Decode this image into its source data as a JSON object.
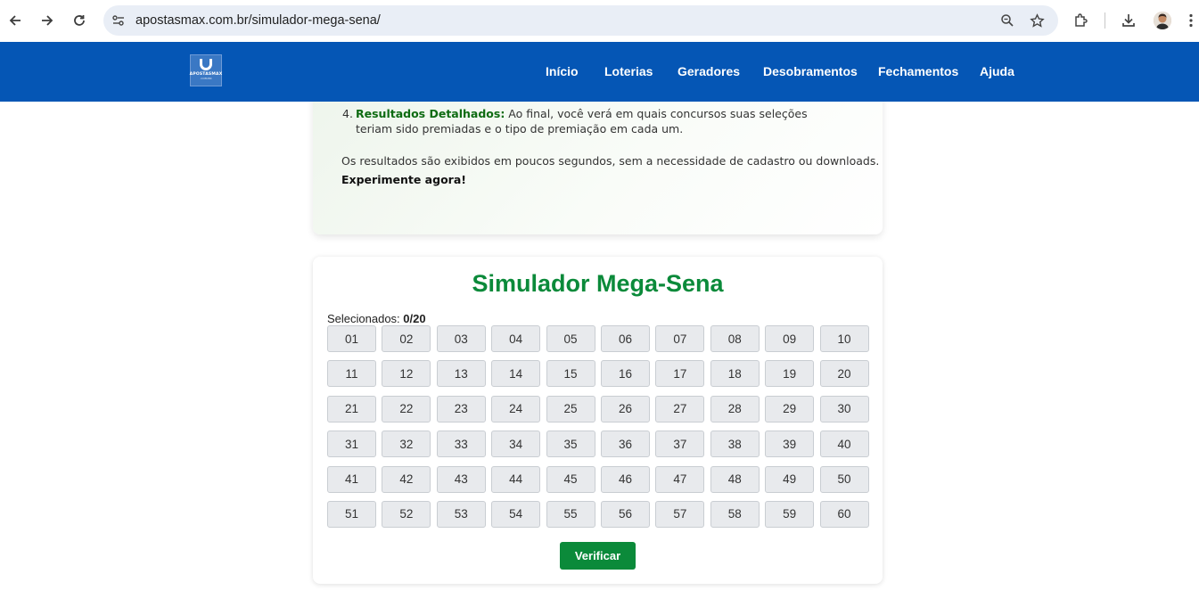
{
  "browser": {
    "url": "apostasmax.com.br/simulador-mega-sena/",
    "icons": [
      "back-icon",
      "forward-icon",
      "reload-icon",
      "site-settings-icon",
      "zoom-icon",
      "bookmark-star-icon",
      "extensions-icon",
      "download-icon",
      "profile-avatar",
      "more-menu-icon"
    ]
  },
  "header": {
    "logo_text": "APOSTASMAX",
    "logo_sub": ".COM.BR",
    "menu": [
      "Início",
      "Loterias",
      "Geradores",
      "Desobramentos",
      "Fechamentos",
      "Ajuda"
    ]
  },
  "info": {
    "item_number": "4.",
    "item_title": "Resultados Detalhados:",
    "item_text": " Ao final, você verá em quais concursos suas seleções teriam sido premiadas e o tipo de premiação em cada um.",
    "paragraph": "Os resultados são exibidos em poucos segundos, sem a necessidade de cadastro ou downloads.",
    "cta": "Experimente agora!"
  },
  "simulator": {
    "title": "Simulador Mega-Sena",
    "selected_label": "Selecionados: ",
    "selected_value": "0/20",
    "numbers": [
      "01",
      "02",
      "03",
      "04",
      "05",
      "06",
      "07",
      "08",
      "09",
      "10",
      "11",
      "12",
      "13",
      "14",
      "15",
      "16",
      "17",
      "18",
      "19",
      "20",
      "21",
      "22",
      "23",
      "24",
      "25",
      "26",
      "27",
      "28",
      "29",
      "30",
      "31",
      "32",
      "33",
      "34",
      "35",
      "36",
      "37",
      "38",
      "39",
      "40",
      "41",
      "42",
      "43",
      "44",
      "45",
      "46",
      "47",
      "48",
      "49",
      "50",
      "51",
      "52",
      "53",
      "54",
      "55",
      "56",
      "57",
      "58",
      "59",
      "60"
    ],
    "verify_label": "Verificar"
  },
  "colors": {
    "header_blue": "#0556b5",
    "title_green": "#0b8a3a",
    "button_green": "#0b8a3a",
    "highlight_green": "#0e6b12"
  }
}
